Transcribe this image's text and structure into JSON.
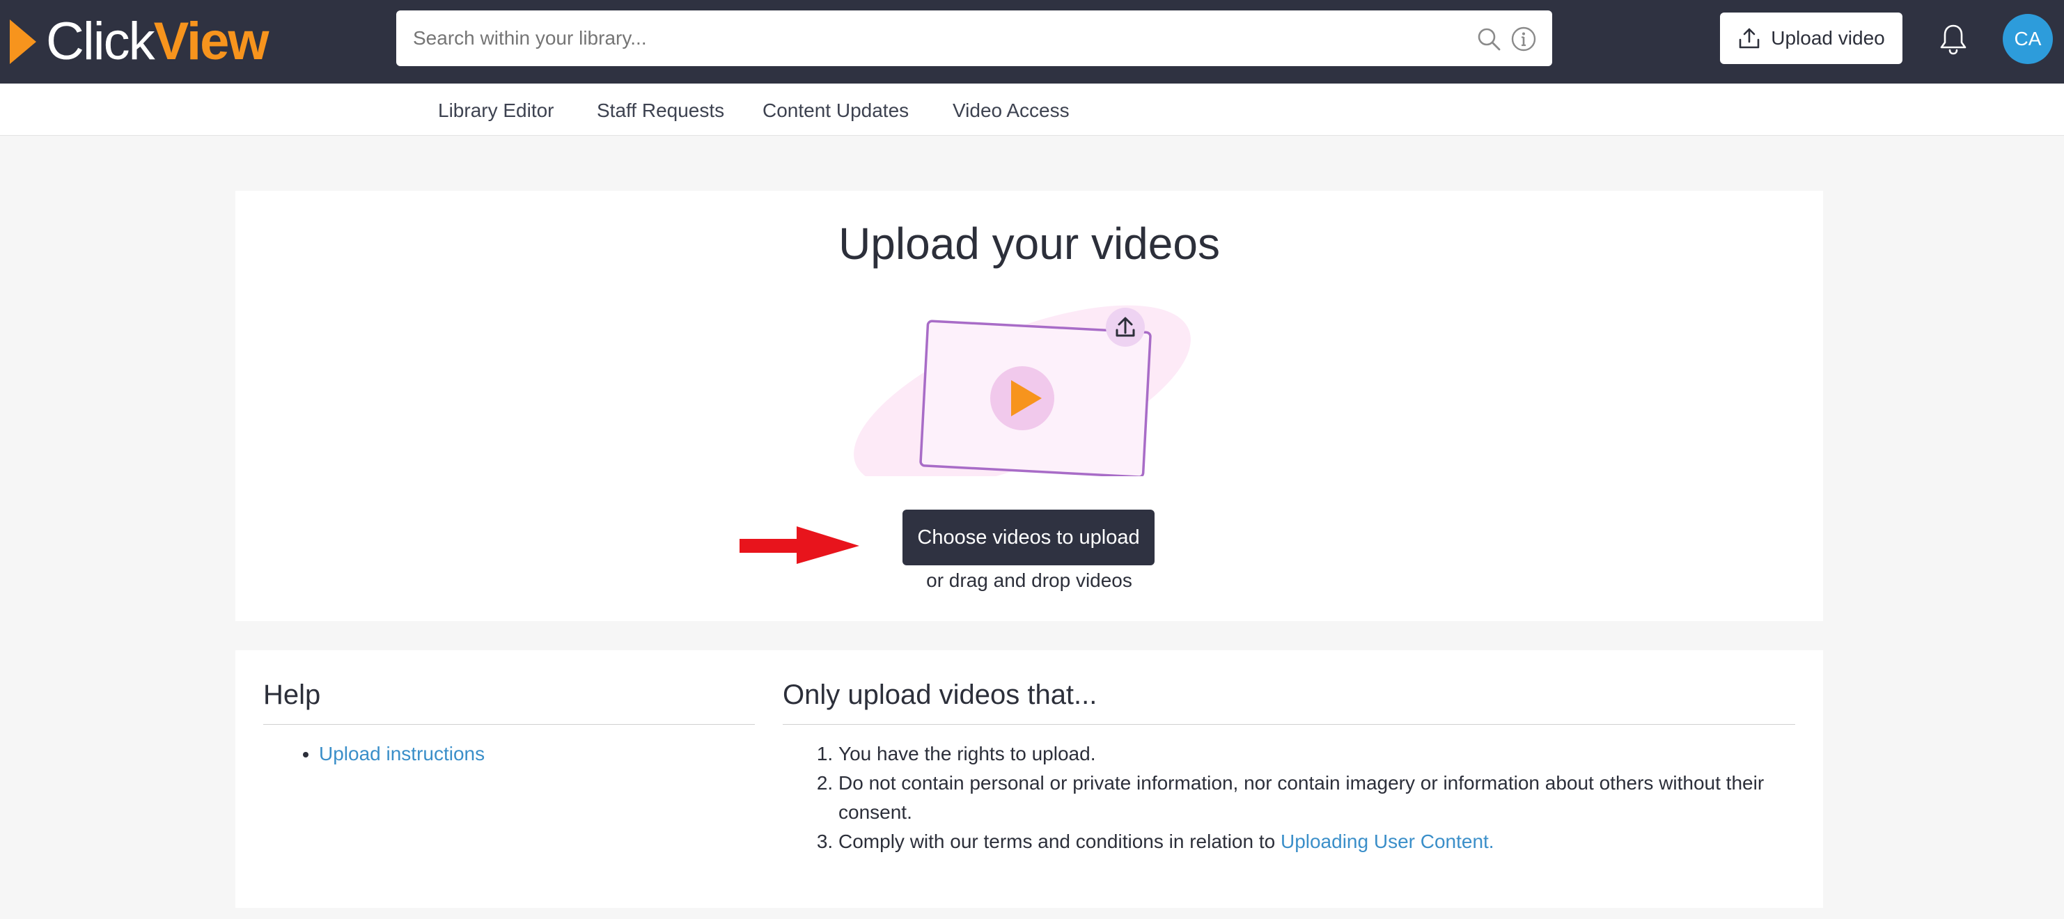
{
  "header": {
    "logo": {
      "part1": "Click",
      "part2": "View"
    },
    "search": {
      "placeholder": "Search within your library...",
      "value": ""
    },
    "upload_button_label": "Upload video",
    "avatar_initials": "CA"
  },
  "subnav": {
    "items": [
      {
        "label": "Library Editor"
      },
      {
        "label": "Staff Requests"
      },
      {
        "label": "Content Updates"
      },
      {
        "label": "Video Access"
      }
    ]
  },
  "upload": {
    "title": "Upload your videos",
    "choose_button_label": "Choose videos to upload",
    "drag_text": "or drag and drop videos"
  },
  "help": {
    "heading": "Help",
    "links": [
      {
        "label": "Upload instructions"
      }
    ]
  },
  "rules": {
    "heading": "Only upload videos that...",
    "items": [
      {
        "text": "You have the rights to upload."
      },
      {
        "text": "Do not contain personal or private information, nor contain imagery or information about others without their consent."
      },
      {
        "text": "Comply with our terms and conditions in relation to ",
        "link": "Uploading User Content."
      }
    ]
  },
  "colors": {
    "topbar": "#2f3241",
    "brand_orange": "#f7941d",
    "avatar_blue": "#2d9cdb",
    "link_blue": "#3b8fc9",
    "annotation_arrow_red": "#e8141c"
  },
  "icons": {
    "search": "search-icon",
    "info": "info-icon",
    "upload": "upload-icon",
    "bell": "bell-icon",
    "play": "play-icon"
  }
}
